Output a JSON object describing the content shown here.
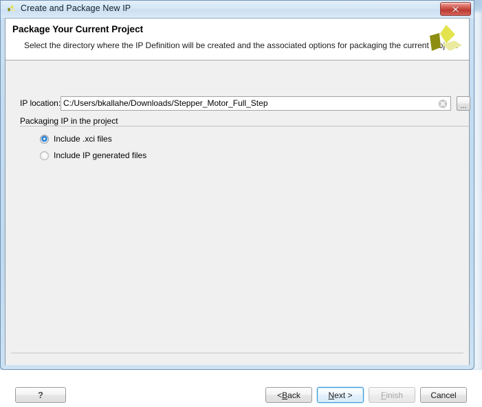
{
  "window": {
    "title": "Create and Package New IP",
    "title_icon": "xilinx-logo-icon",
    "close_label": "x"
  },
  "header": {
    "title": "Package Your Current Project",
    "description": "Select the directory where the IP Definition will be created and the associated options for packaging the current project.",
    "logo_icon": "xilinx-logo"
  },
  "form": {
    "ip_location_label": "IP location:",
    "ip_location_value": "C:/Users/bkallahe/Downloads/Stepper_Motor_Full_Step",
    "ip_location_placeholder": "",
    "clear_icon": "clear-circle-x-icon",
    "browse_label": "...",
    "group_label": "Packaging IP in the project",
    "options": [
      {
        "label": "Include .xci files",
        "selected": true
      },
      {
        "label": "Include IP generated files",
        "selected": false
      }
    ]
  },
  "footer": {
    "help_label": "?",
    "back_label": "< Back",
    "back_prefix": "< ",
    "back_mnemonic": "B",
    "back_suffix": "ack",
    "next_prefix": "",
    "next_mnemonic": "N",
    "next_suffix": "ext >",
    "next_label": "Next >",
    "finish_prefix": "",
    "finish_mnemonic": "F",
    "finish_suffix": "inish",
    "finish_label": "Finish",
    "finish_enabled": false,
    "cancel_label": "Cancel",
    "next_is_default": true
  },
  "colors": {
    "accent_blue": "#3c9bd9",
    "brand_yellow": "#d6d62e",
    "brand_olive": "#8a8a12",
    "close_red": "#c4473d",
    "header_bg": "#ffffff",
    "body_bg": "#f0f0f0"
  }
}
